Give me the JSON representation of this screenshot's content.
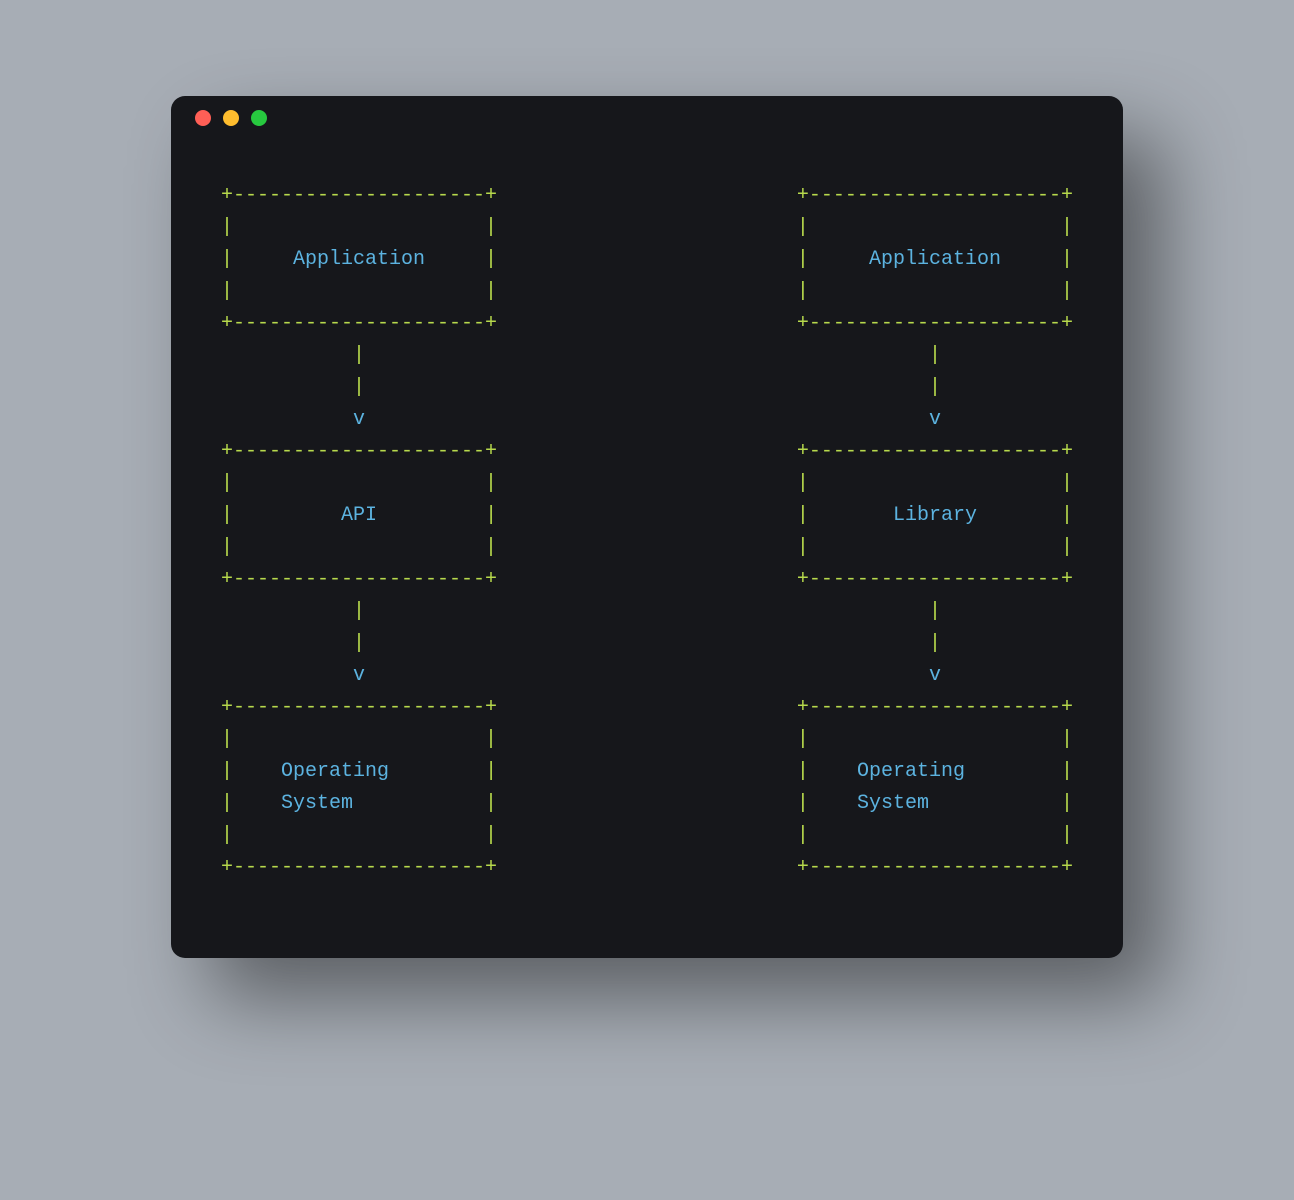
{
  "window": {
    "traffic_lights": [
      "close",
      "minimize",
      "zoom"
    ]
  },
  "diagram": {
    "left": {
      "boxes": [
        "Application",
        "API",
        "Operating System"
      ],
      "arrows": [
        "v",
        "v"
      ]
    },
    "right": {
      "boxes": [
        "Application",
        "Library",
        "Operating System"
      ],
      "arrows": [
        "v",
        "v"
      ]
    }
  }
}
